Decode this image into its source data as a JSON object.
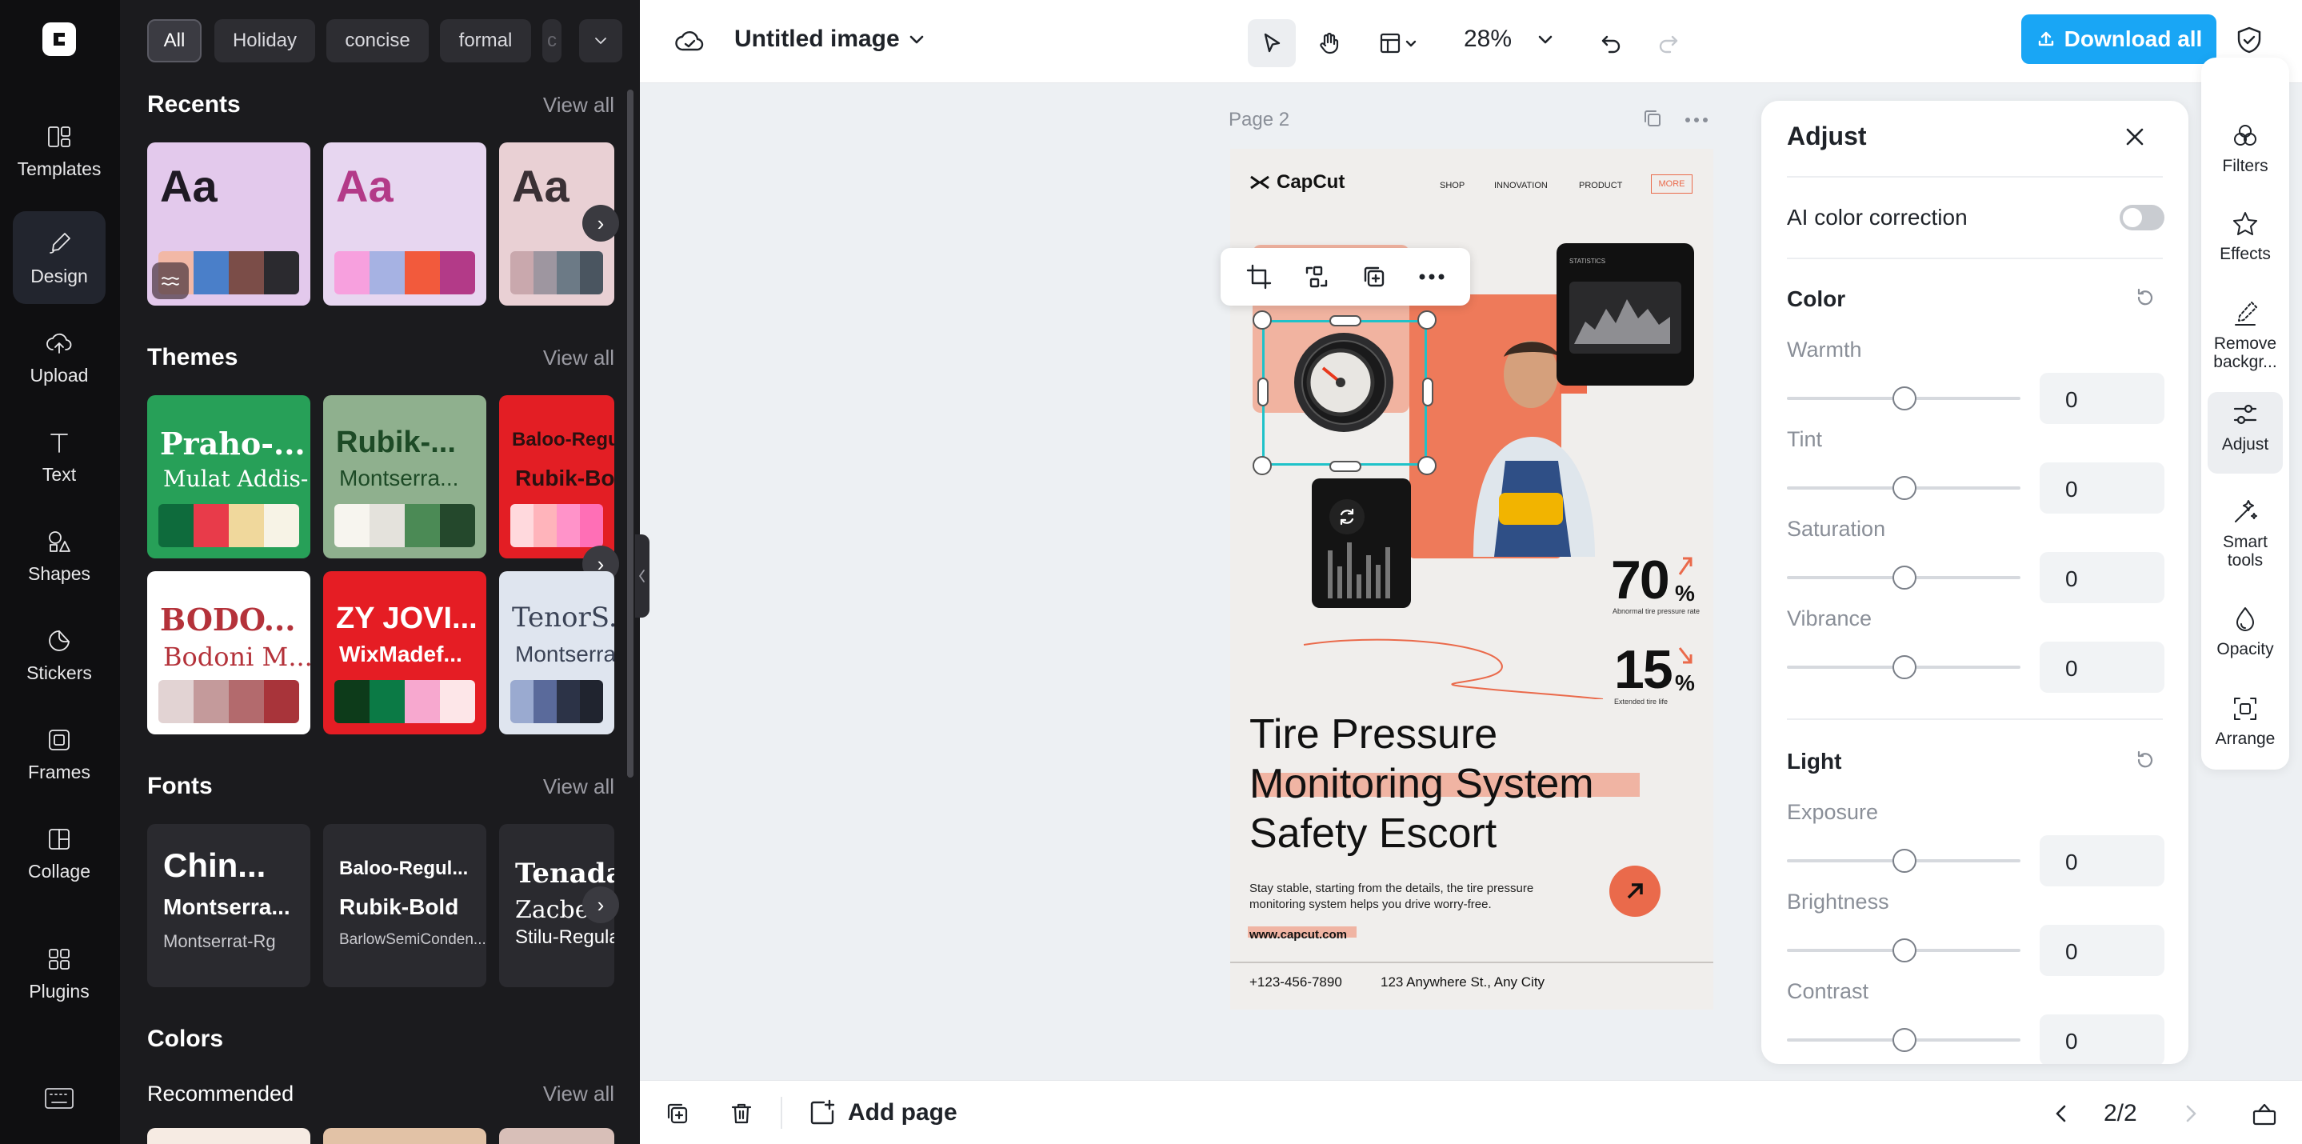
{
  "rail": {
    "items": [
      {
        "label": "Templates",
        "icon": "templates-icon"
      },
      {
        "label": "Design",
        "icon": "design-icon"
      },
      {
        "label": "Upload",
        "icon": "upload-icon"
      },
      {
        "label": "Text",
        "icon": "text-icon"
      },
      {
        "label": "Shapes",
        "icon": "shapes-icon"
      },
      {
        "label": "Stickers",
        "icon": "stickers-icon"
      },
      {
        "label": "Frames",
        "icon": "frames-icon"
      },
      {
        "label": "Collage",
        "icon": "collage-icon"
      },
      {
        "label": "Plugins",
        "icon": "plugins-icon"
      }
    ]
  },
  "panel": {
    "chips": [
      "All",
      "Holiday",
      "concise",
      "formal"
    ],
    "view_all": "View all",
    "recents": {
      "title": "Recents",
      "cards": [
        {
          "sample": "Aa",
          "colors": [
            "#f2b8a6",
            "#4a7fc9",
            "#7b4d48",
            "#2b2a2f"
          ]
        },
        {
          "sample": "Aa",
          "colors": [
            "#f7a0de",
            "#a6b2e3",
            "#f25a3c",
            "#b33a88"
          ]
        },
        {
          "sample": "Aa",
          "colors": [
            "#c9a8ad",
            "#9e96a0",
            "#6c7a86",
            "#4a5560"
          ]
        }
      ]
    },
    "themes": {
      "title": "Themes",
      "cards": [
        {
          "heading": "Praho-...",
          "sub": "Mulat Addis-...",
          "bg": "#27a058",
          "fg": "#ffffff",
          "colors": [
            "#0e6b3c",
            "#e83b4a",
            "#f0d89c",
            "#f7f3e6"
          ]
        },
        {
          "heading": "Rubik-...",
          "sub": "Montserra...",
          "bg": "#8fb08e",
          "fg": "#1d4a26",
          "colors": [
            "#f7f5ef",
            "#e4e2dc",
            "#4b8a55",
            "#24482c"
          ]
        },
        {
          "heading": "Baloo-Regu",
          "sub": "Rubik-Bo",
          "bg": "#e31e24",
          "fg": "#2b1010",
          "colors": [
            "#ffd9dd",
            "#ffb4bb",
            "#ff93c9",
            "#ff6fb6"
          ]
        },
        {
          "heading": "BODO...",
          "sub": "Bodoni M...",
          "bg": "#ffffff",
          "fg": "#b4323a",
          "colors": [
            "#e2d3d3",
            "#c49a9b",
            "#b36a6d",
            "#a8343a"
          ]
        },
        {
          "heading": "ZY JOVI...",
          "sub": "WixMadef...",
          "bg": "#e51d24",
          "fg": "#ffffff",
          "colors": [
            "#0d3b1a",
            "#0b7a45",
            "#f7a8cf",
            "#fde6e8"
          ]
        },
        {
          "heading": "TenorS...",
          "sub": "Montserra",
          "bg": "#dfe5ef",
          "fg": "#3b4356",
          "colors": [
            "#9aaad0",
            "#5a6a9b",
            "#2c3347",
            "#20242f"
          ]
        }
      ]
    },
    "fonts": {
      "title": "Fonts",
      "cards": [
        {
          "l1": "Chin...",
          "l2": "Montserra...",
          "l3": "Montserrat-Rg"
        },
        {
          "l1": "Baloo-Regul...",
          "l2": "Rubik-Bold",
          "l3": "BarlowSemiConden..."
        },
        {
          "l1": "Tenada",
          "l2": "Zacbe",
          "l3": "Stilu-Regula"
        }
      ]
    },
    "colors": {
      "title": "Colors",
      "recommended": "Recommended",
      "swatches": [
        "#f6ebe3",
        "#e2c2a6",
        "#d8bfb8"
      ]
    }
  },
  "topbar": {
    "title": "Untitled image",
    "zoom": "28%",
    "download": "Download all"
  },
  "bottombar": {
    "add_page": "Add page",
    "page": "2/2"
  },
  "canvas": {
    "page_label": "Page 2"
  },
  "poster": {
    "brand": "CapCut",
    "nav": [
      "SHOP",
      "INNOVATION",
      "PRODUCT",
      "MORE"
    ],
    "statistics": "STATISTICS",
    "stat1_value": "70",
    "stat1_unit": "%",
    "stat1_label": "Abnormal tire pressure rate",
    "stat2_value": "15",
    "stat2_unit": "%",
    "stat2_label": "Extended tire life",
    "headline": [
      "Tire Pressure",
      "Monitoring System",
      "Safety Escort"
    ],
    "body": [
      "Stay stable, starting from the details, the tire pressure",
      "monitoring system helps you drive worry-free."
    ],
    "url": "www.capcut.com",
    "phone": "+123-456-7890",
    "address": "123 Anywhere St., Any City",
    "accent": "#ea6a4b"
  },
  "adjust": {
    "title": "Adjust",
    "ai_label": "AI color correction",
    "color_title": "Color",
    "light_title": "Light",
    "color_rows": [
      {
        "label": "Warmth",
        "value": "0"
      },
      {
        "label": "Tint",
        "value": "0"
      },
      {
        "label": "Saturation",
        "value": "0"
      },
      {
        "label": "Vibrance",
        "value": "0"
      }
    ],
    "light_rows": [
      {
        "label": "Exposure",
        "value": "0"
      },
      {
        "label": "Brightness",
        "value": "0"
      },
      {
        "label": "Contrast",
        "value": "0"
      }
    ]
  },
  "tools": [
    {
      "label": "Filters"
    },
    {
      "label": "Effects"
    },
    {
      "label": "Remove backgr..."
    },
    {
      "label": "Adjust"
    },
    {
      "label": "Smart tools"
    },
    {
      "label": "Opacity"
    },
    {
      "label": "Arrange"
    }
  ]
}
